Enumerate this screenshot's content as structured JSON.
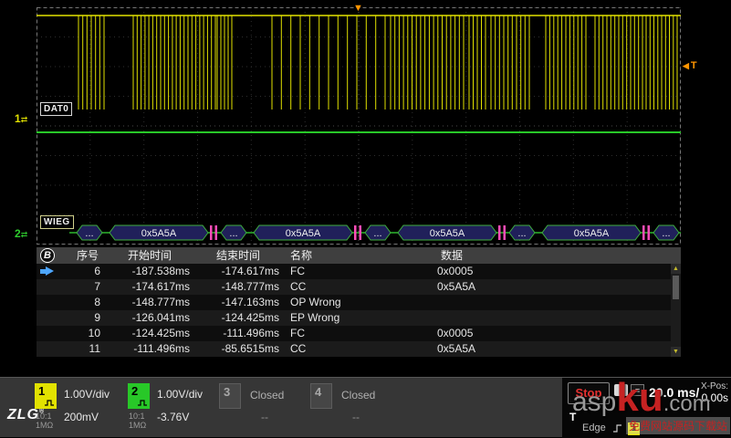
{
  "scope": {
    "ch1_bus_label": "DAT0",
    "ch2_bus_label": "WIEG",
    "ch1_marker": "1",
    "ch2_marker": "2",
    "trigger_marker": "T"
  },
  "bus": {
    "ellipsis": "...",
    "value": "0x5A5A"
  },
  "waveform": {
    "ch1_color": "#e2e200",
    "ch2_color": "#28c828",
    "bus_line_color": "#2eb82e",
    "error_mark_color": "#ff4db8",
    "pulse_groups": [
      {
        "start": 46,
        "end": 74,
        "count": 7
      },
      {
        "start": 106,
        "end": 196,
        "count": 22
      },
      {
        "start": 198,
        "end": 214,
        "count": 5
      },
      {
        "start": 258,
        "end": 382,
        "count": 13
      },
      {
        "start": 388,
        "end": 468,
        "count": 18
      },
      {
        "start": 474,
        "end": 492,
        "count": 5
      },
      {
        "start": 498,
        "end": 540,
        "count": 10
      },
      {
        "start": 558,
        "end": 602,
        "count": 11
      },
      {
        "start": 612,
        "end": 664,
        "count": 13
      },
      {
        "start": 668,
        "end": 702,
        "count": 9
      }
    ]
  },
  "table": {
    "bus_badge": "B",
    "headers": [
      "序号",
      "开始时间",
      "结束时间",
      "名称",
      "数据"
    ],
    "rows": [
      [
        "6",
        "-187.538ms",
        "-174.617ms",
        "FC",
        "0x0005"
      ],
      [
        "7",
        "-174.617ms",
        "-148.777ms",
        "CC",
        "0x5A5A"
      ],
      [
        "8",
        "-148.777ms",
        "-147.163ms",
        "OP Wrong",
        ""
      ],
      [
        "9",
        "-126.041ms",
        "-124.425ms",
        "EP Wrong",
        ""
      ],
      [
        "10",
        "-124.425ms",
        "-111.496ms",
        "FC",
        "0x0005"
      ],
      [
        "11",
        "-111.496ms",
        "-85.6515ms",
        "CC",
        "0x5A5A"
      ]
    ],
    "selected_row": 0
  },
  "statusbar": {
    "channels": [
      {
        "num": "1",
        "vdiv": "1.00V/div",
        "offset": "200mV",
        "probe": "10:1",
        "impedance": "1MΩ"
      },
      {
        "num": "2",
        "vdiv": "1.00V/div",
        "offset": "-3.76V",
        "probe": "10:1",
        "impedance": "1MΩ"
      },
      {
        "num": "3",
        "state": "Closed",
        "offset": "--"
      },
      {
        "num": "4",
        "state": "Closed",
        "offset": "--"
      }
    ],
    "run_state": "Stop",
    "chip1": "1",
    "chip2": "≡",
    "timebase": "20.0 ms/",
    "xpos_label": "X-Pos:",
    "xpos_value": "0.00s",
    "trigger_label": "T",
    "trigger_type": "Edge",
    "trigger_source": "1"
  },
  "logo": "ZLG",
  "logo_reg": "®",
  "icons": {
    "trigger_down": "▼",
    "trigger_left": "◀",
    "scroll_up": "▲",
    "scroll_down": "▼",
    "channel_marker": "⇄"
  },
  "watermark": {
    "part1": "asp",
    "part2": "ku",
    "part3": ".com",
    "tagline": "免费网站源码下载站"
  }
}
